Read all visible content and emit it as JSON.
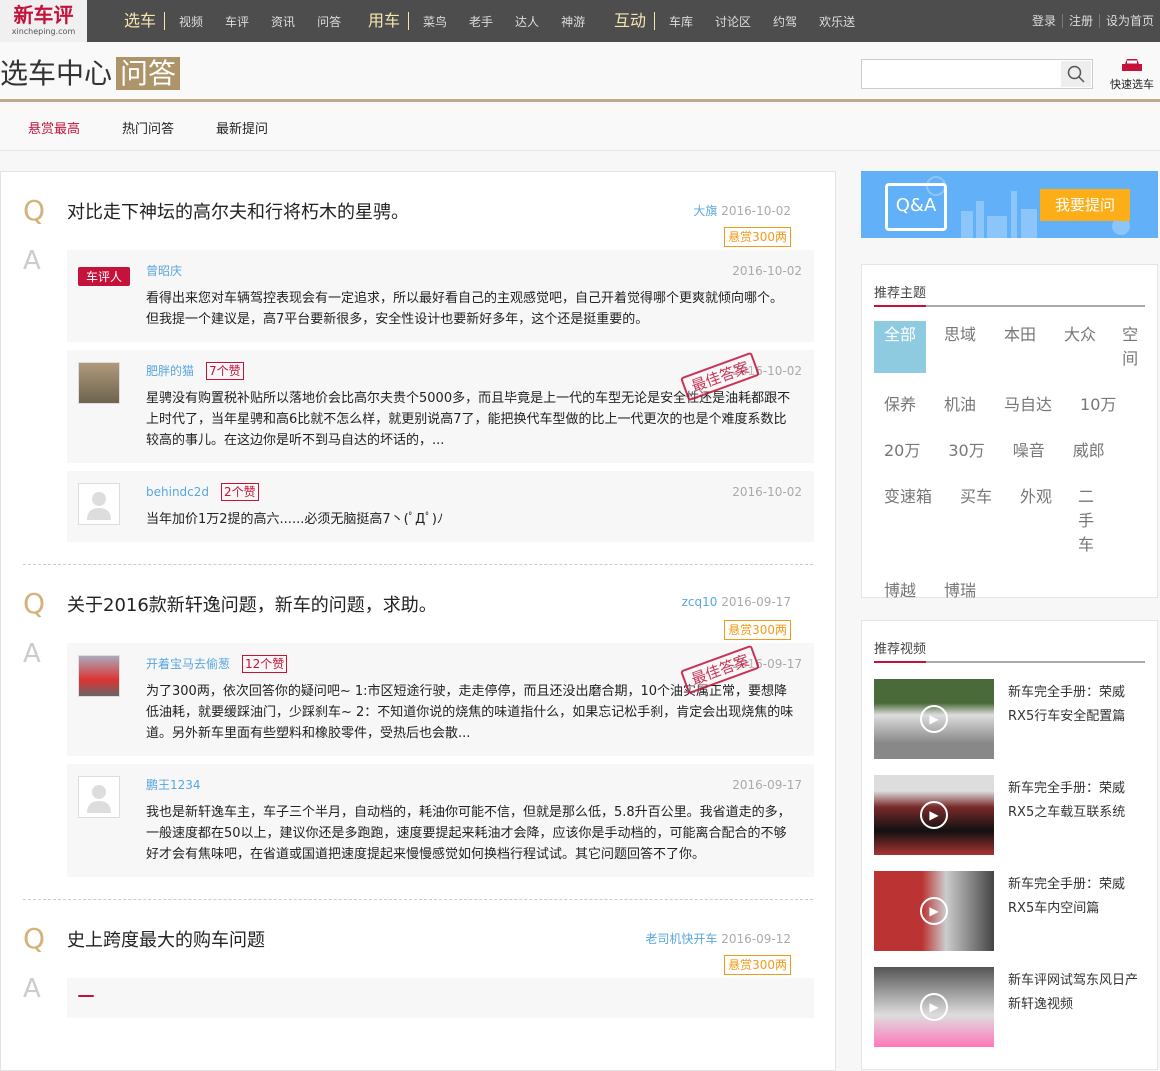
{
  "nav": {
    "logo": "新车评",
    "logo_sub": "xincheping.com",
    "groups": [
      {
        "title": "选车",
        "items": [
          "视频",
          "车评",
          "资讯",
          "问答"
        ]
      },
      {
        "title": "用车",
        "items": [
          "菜鸟",
          "老手",
          "达人",
          "神游"
        ]
      },
      {
        "title": "互动",
        "items": [
          "车库",
          "讨论区",
          "约驾",
          "欢乐送"
        ]
      }
    ],
    "right": [
      "登录",
      "注册",
      "设为首页"
    ]
  },
  "header": {
    "title": "选车中心",
    "highlight": "问答",
    "search_placeholder": "",
    "quick_select": "快速选车"
  },
  "tabs": [
    "悬赏最高",
    "热门问答",
    "最新提问"
  ],
  "questions": [
    {
      "title": "对比走下神坛的高尔夫和行将朽木的星骋。",
      "user": "大旗",
      "date": "2016-10-02",
      "reward": "悬赏300两",
      "answers": [
        {
          "badge": "车评人",
          "user": "曾昭庆",
          "likes": "",
          "date": "2016-10-02",
          "best": false,
          "text": "看得出来您对车辆驾控表现会有一定追求，所以最好看自己的主观感觉吧，自己开着觉得哪个更爽就倾向哪个。但我提一个建议是，高7平台要新很多，安全性设计也要新好多年，这个还是挺重要的。"
        },
        {
          "badge": "",
          "user": "肥胖的猫",
          "likes": "7个赞",
          "date": "2016-10-02",
          "best": true,
          "text": "星骋没有购置税补贴所以落地价会比高尔夫贵个5000多，而且毕竟是上一代的车型无论是安全性还是油耗都跟不上时代了，当年星骋和高6比就不怎么样，就更别说高7了，能把换代车型做的比上一代更次的也是个难度系数比较高的事儿。在这边你是听不到马自达的坏话的，..."
        },
        {
          "badge": "",
          "user": "behindc2d",
          "likes": "2个赞",
          "date": "2016-10-02",
          "best": false,
          "text": "当年加价1万2提的高六......必须无脑挺高7丶(ﾟДﾟ)ﾉ"
        }
      ]
    },
    {
      "title": "关于2016款新轩逸问题，新车的问题，求助。",
      "user": "zcq10",
      "date": "2016-09-17",
      "reward": "悬赏300两",
      "answers": [
        {
          "badge": "",
          "user": "开着宝马去偷葱",
          "likes": "12个赞",
          "date": "2016-09-17",
          "best": true,
          "text": "为了300两，依次回答你的疑问吧~ 1:市区短途行驶，走走停停，而且还没出磨合期，10个油实属正常，要想降低油耗，就要缓踩油门，少踩刹车~ 2：不知道你说的烧焦的味道指什么，如果忘记松手刹，肯定会出现烧焦的味道。另外新车里面有些塑料和橡胶零件，受热后也会散..."
        },
        {
          "badge": "",
          "user": "鹏王1234",
          "likes": "",
          "date": "2016-09-17",
          "best": false,
          "text": "我也是新轩逸车主，车子三个半月，自动档的，耗油你可能不信，但就是那么低，5.8升百公里。我省道走的多，一般速度都在50以上，建议你还是多跑跑，速度要提起来耗油才会降，应该你是手动档的，可能离合配合的不够好才会有焦味吧，在省道或国道把速度提起来慢慢感觉如何换档行程试试。其它问题回答不了你。"
        }
      ]
    },
    {
      "title": "史上跨度最大的购车问题",
      "user": "老司机快开车",
      "date": "2016-09-12",
      "reward": "悬赏300两",
      "answers": []
    }
  ],
  "best_stamp": "最佳答案",
  "q_letter": "Q",
  "a_letter": "A",
  "sidebar": {
    "banner_logo": "Q&A",
    "ask_button": "我要提问",
    "topics_title": "推荐主题",
    "topics": [
      "全部",
      "思域",
      "本田",
      "大众",
      "空间",
      "保养",
      "机油",
      "马自达",
      "10万",
      "20万",
      "30万",
      "噪音",
      "威郎",
      "变速箱",
      "买车",
      "外观",
      "二手车",
      "博越",
      "博瑞"
    ],
    "videos_title": "推荐视频",
    "videos": [
      "新车完全手册：荣威RX5行车安全配置篇",
      "新车完全手册：荣威RX5之车载互联系统",
      "新车完全手册：荣威RX5车内空间篇",
      "新车评网试驾东风日产新轩逸视频"
    ]
  },
  "colors": {
    "brand": "#c4123a",
    "accent": "#ad9469",
    "reward": "#f29b1a",
    "link": "#5aa6e0"
  }
}
